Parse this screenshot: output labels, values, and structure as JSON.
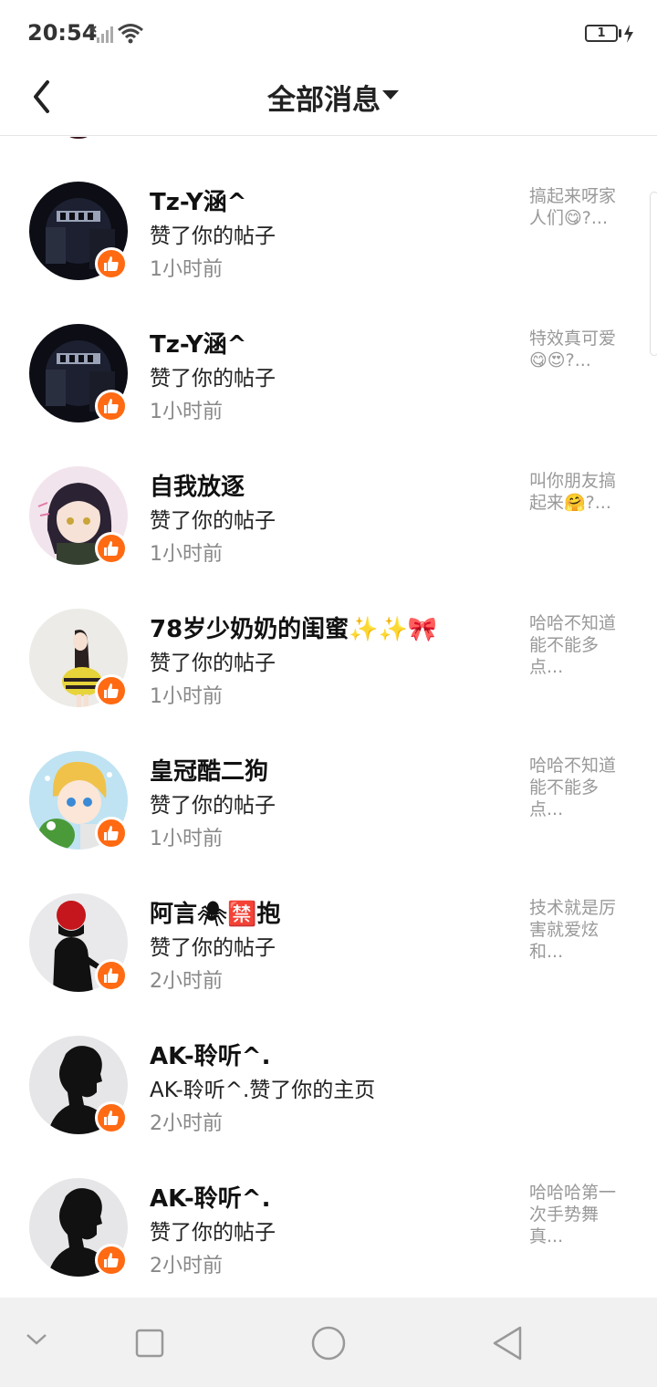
{
  "status_bar": {
    "time": "20:54",
    "battery": "1"
  },
  "header": {
    "title": "全部消息"
  },
  "notifications": [
    {
      "name": "Tz-Y涵^",
      "action": "赞了你的帖子",
      "time": "1小时前",
      "preview": "搞起来呀家人们😋?..."
    },
    {
      "name": "Tz-Y涵^",
      "action": "赞了你的帖子",
      "time": "1小时前",
      "preview": "特效真可爱😋😍?..."
    },
    {
      "name": "自我放逐",
      "action": "赞了你的帖子",
      "time": "1小时前",
      "preview": "叫你朋友搞起来🤗?..."
    },
    {
      "name": "78岁少奶奶的闺蜜✨✨🎀",
      "action": "赞了你的帖子",
      "time": "1小时前",
      "preview": "哈哈不知道能不能多点..."
    },
    {
      "name": "皇冠酷二狗",
      "action": "赞了你的帖子",
      "time": "1小时前",
      "preview": "哈哈不知道能不能多点..."
    },
    {
      "name": "阿言🕷🈲抱",
      "action": "赞了你的帖子",
      "time": "2小时前",
      "preview": "技术就是厉害就爱炫和..."
    },
    {
      "name": "AK-聆听^.",
      "action": "AK-聆听^.赞了你的主页",
      "time": "2小时前",
      "preview": ""
    },
    {
      "name": "AK-聆听^.",
      "action": "赞了你的帖子",
      "time": "2小时前",
      "preview": "哈哈哈第一次手势舞真..."
    }
  ],
  "colors": {
    "like_badge": "#ff6a13",
    "time_text": "#888888",
    "preview_text": "#999999"
  }
}
